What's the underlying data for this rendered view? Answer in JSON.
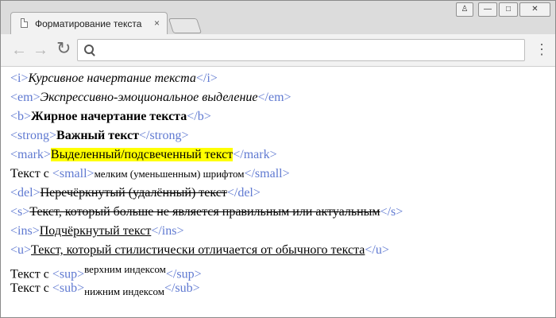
{
  "window": {
    "tab_title": "Форматирование текста",
    "tab_close": "×",
    "profile_icon": "person-icon",
    "min_label": "—",
    "max_label": "□",
    "close_label": "✕"
  },
  "toolbar": {
    "back": "←",
    "forward": "→",
    "reload": "↻",
    "address_placeholder": "",
    "menu": "⋮"
  },
  "content": {
    "lines": [
      {
        "open": "<i>",
        "text": "Курсивное начертание текста",
        "close": "</i>"
      },
      {
        "open": "<em>",
        "text": "Экспрессивно-эмоциональное выделение",
        "close": "</em>"
      },
      {
        "open": "<b>",
        "text": "Жирное начертание текста",
        "close": "</b>"
      },
      {
        "open": "<strong>",
        "text": "Важный текст",
        "close": "</strong>"
      },
      {
        "open": "<mark>",
        "text": "Выделенный/подсвеченный текст",
        "close": "</mark>"
      },
      {
        "prefix": "Текст с ",
        "open": "<small>",
        "text": "мелким (уменьшенным) шрифтом",
        "close": "</small>"
      },
      {
        "open": "<del>",
        "text": "Перечёркнутый (удалённый) текст",
        "close": "</del>"
      },
      {
        "open": "<s>",
        "text": "Текст, который больше не является правильным или актуальным",
        "close": "</s>"
      },
      {
        "open": "<ins>",
        "text": "Подчёркнутый текст",
        "close": "</ins>"
      },
      {
        "open": "<u>",
        "text": "Текст, который стилистически отличается от обычного текста",
        "close": "</u>"
      },
      {
        "prefix": "Текст с ",
        "open": "<sup>",
        "text": "верхним индексом",
        "close": "</sup>"
      },
      {
        "prefix": "Текст с ",
        "open": "<sub>",
        "text": "нижним индексом",
        "close": "</sub>"
      }
    ]
  }
}
